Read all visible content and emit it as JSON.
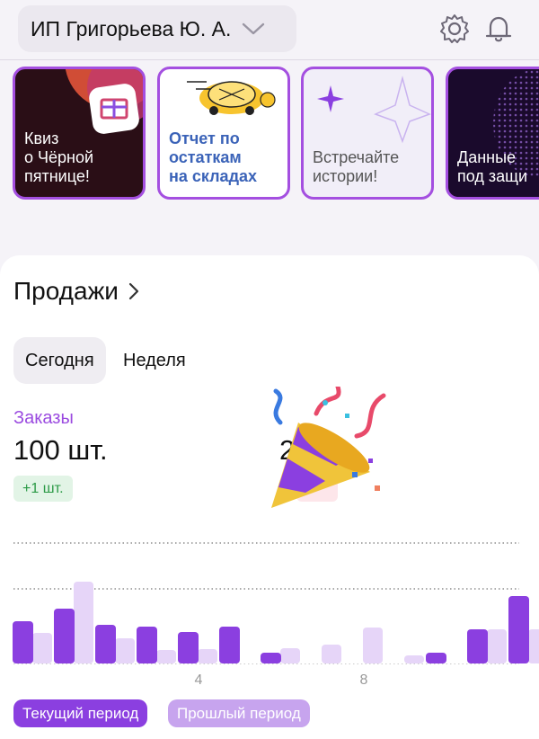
{
  "header": {
    "account_name": "ИП Григорьева Ю. А.",
    "icons": [
      "chevron-down-icon",
      "gear-icon",
      "bell-icon"
    ]
  },
  "stories": [
    {
      "label": "Квиз\nо Чёрной\nпятнице!",
      "lines": [
        "Квиз",
        "о Чёрной",
        "пятнице!"
      ]
    },
    {
      "label": "Отчет по остаткам на складах",
      "lines": [
        "Отчет по",
        "остаткам",
        "на складах"
      ]
    },
    {
      "label": "Встречайте истории!",
      "lines": [
        "Встречайте",
        "истории!"
      ]
    },
    {
      "label": "Данные под защи",
      "lines": [
        "Данные",
        "под защи"
      ]
    }
  ],
  "sales": {
    "title": "Продажи",
    "tabs": [
      {
        "label": "Сегодня",
        "active": true
      },
      {
        "label": "Неделя",
        "active": false
      }
    ],
    "orders_label": "Заказы",
    "orders_value": "100 шт.",
    "orders_delta": "+1 шт.",
    "revenue_value": "2   ₽"
  },
  "chart_data": {
    "type": "bar",
    "x_ticks": [
      "4",
      "8"
    ],
    "series": [
      {
        "name": "Текущий период",
        "color": "#8b3fe0",
        "values": [
          47,
          61,
          43,
          41,
          35,
          41,
          12,
          0,
          0,
          0,
          12,
          38,
          75
        ]
      },
      {
        "name": "Прошлый период",
        "color": "#e6d5f8",
        "values": [
          34,
          91,
          28,
          15,
          16,
          0,
          17,
          21,
          40,
          9,
          0,
          38,
          38
        ]
      }
    ],
    "categories": [
      "1",
      "2",
      "3",
      "4",
      "5",
      "6",
      "7",
      "8",
      "9",
      "10",
      "11",
      "12",
      "13"
    ],
    "gridlines": "dotted"
  },
  "legend": {
    "current": "Текущий период",
    "previous": "Прошлый период"
  },
  "colors": {
    "accent": "#8b3fe0",
    "accent_light": "#c7a4ee",
    "positive": "#2b9a46"
  }
}
